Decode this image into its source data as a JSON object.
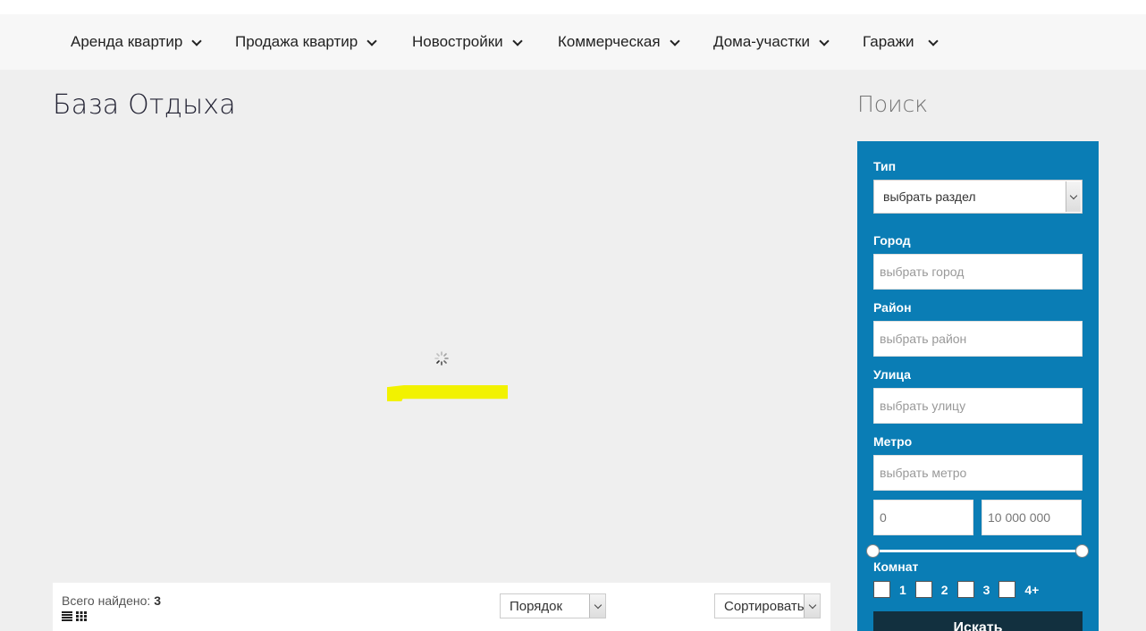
{
  "nav": {
    "items": [
      {
        "label": "Аренда квартир"
      },
      {
        "label": "Продажа квартир"
      },
      {
        "label": "Новостройки"
      },
      {
        "label": "Коммерческая"
      },
      {
        "label": "Дома-участки"
      },
      {
        "label": "Гаражи"
      }
    ]
  },
  "page": {
    "title": "База Отдыха"
  },
  "results": {
    "found_label": "Всего найдено:",
    "found_count": "3",
    "order_select": "Порядок",
    "sort_select": "Сортировать"
  },
  "search": {
    "title": "Поиск",
    "type_label": "Тип",
    "type_value": "выбрать раздел",
    "city_label": "Город",
    "city_placeholder": "выбрать город",
    "district_label": "Район",
    "district_placeholder": "выбрать район",
    "street_label": "Улица",
    "street_placeholder": "выбрать улицу",
    "metro_label": "Метро",
    "metro_placeholder": "выбрать метро",
    "price_min": "0",
    "price_max": "10 000 000",
    "rooms_label": "Комнат",
    "rooms": [
      "1",
      "2",
      "3",
      "4+"
    ],
    "submit_label": "Искать"
  },
  "colors": {
    "panel": "#0a7db5",
    "button": "#12303f",
    "highlight": "#f2f200"
  }
}
